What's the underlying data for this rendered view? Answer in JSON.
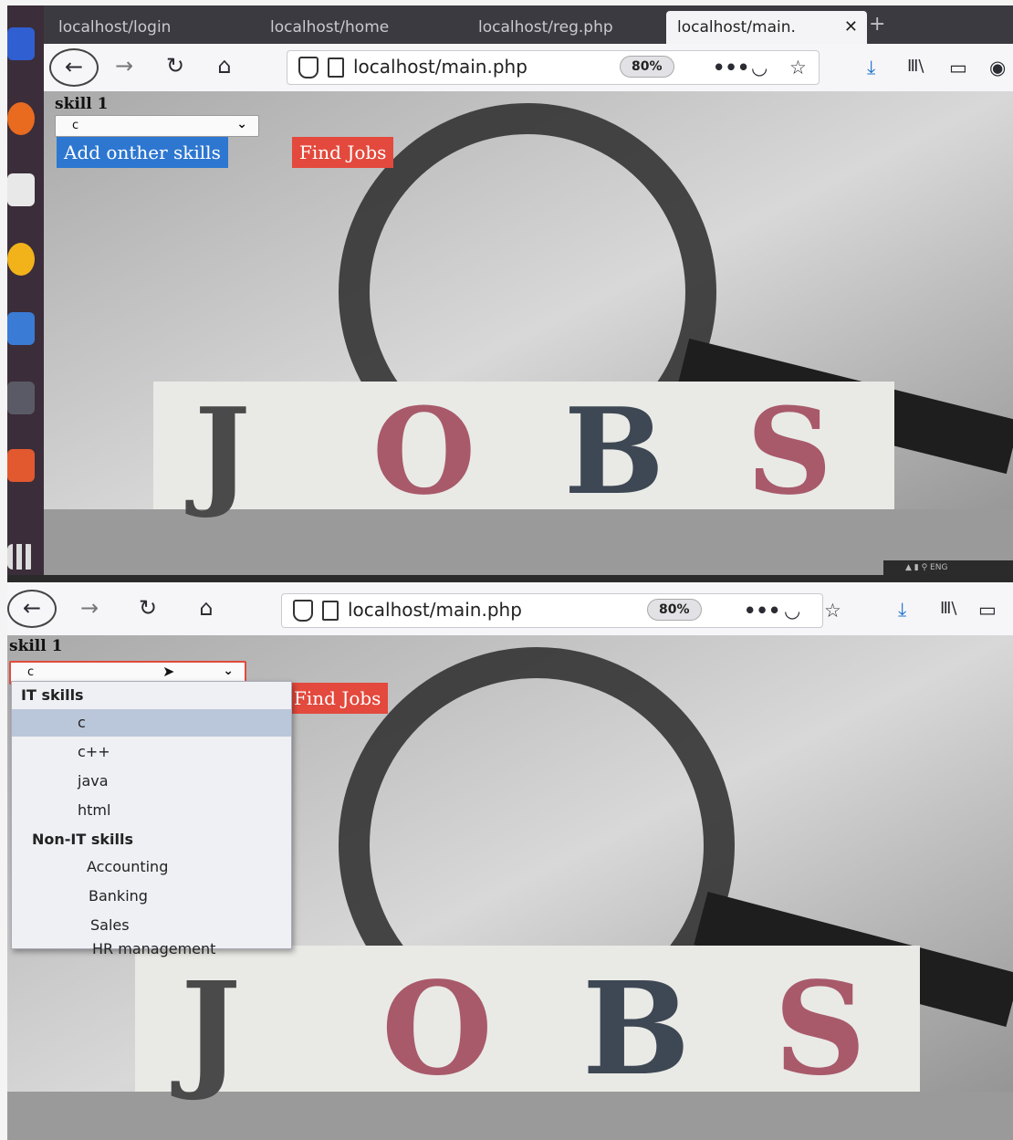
{
  "colors": {
    "add_button": "#2e77d0",
    "find_button": "#e34a3d",
    "select_focus_border": "#e14b3b",
    "tab_strip": "#3a3a40",
    "dropdown_selected": "#bac6da"
  },
  "browser": {
    "tabs": [
      {
        "label": "localhost/login"
      },
      {
        "label": "localhost/home"
      },
      {
        "label": "localhost/reg.php"
      },
      {
        "label": "localhost/main."
      }
    ],
    "new_tab": "+",
    "url": "localhost/main.php",
    "zoom": "80%",
    "icons": [
      "back-arrow-icon",
      "forward-arrow-icon",
      "reload-icon",
      "home-icon",
      "shield-icon",
      "page-icon",
      "more-icon",
      "pocket-icon",
      "star-icon",
      "download-icon",
      "library-icon",
      "sidebar-icon",
      "account-icon"
    ]
  },
  "form": {
    "skill_label": "skill 1",
    "selected_value": "c",
    "add_button": "Add onther skills",
    "find_button": "Find Jobs"
  },
  "dropdown": {
    "groups": [
      {
        "label": "IT skills",
        "options": [
          "c",
          "c++",
          "java",
          "html"
        ]
      },
      {
        "label": "Non-IT skills",
        "options": [
          "Accounting",
          "Banking",
          "Sales",
          "HR management"
        ]
      }
    ],
    "selected": "c"
  },
  "background_image": {
    "letters": [
      "J",
      "O",
      "B",
      "S"
    ]
  }
}
